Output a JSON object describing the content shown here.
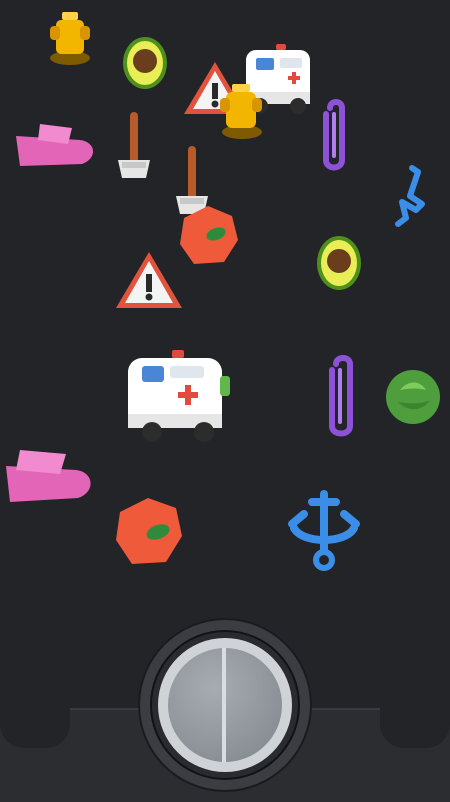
{
  "game": {
    "scene": "3d-object-matching-board",
    "background_color": "#232428",
    "collect_button": {
      "icon": "collect-button",
      "color": "#9ea4ab"
    }
  },
  "objects": [
    {
      "id": "trophy-1",
      "type": "trophy",
      "color": "#f4b400"
    },
    {
      "id": "avocado-1",
      "type": "avocado",
      "color": "#88c33a"
    },
    {
      "id": "warning-sign-1",
      "type": "warning-sign",
      "color": "#e2533d"
    },
    {
      "id": "ambulance-1",
      "type": "ambulance",
      "color": "#ffffff"
    },
    {
      "id": "trophy-2",
      "type": "trophy",
      "color": "#f4b400"
    },
    {
      "id": "paperclip-1",
      "type": "paperclip",
      "color": "#8e52d8"
    },
    {
      "id": "axe-1",
      "type": "axe",
      "color": "#c7642f"
    },
    {
      "id": "slipper-1",
      "type": "slipper",
      "color": "#e365b8"
    },
    {
      "id": "axe-2",
      "type": "axe",
      "color": "#c7642f"
    },
    {
      "id": "peach-1",
      "type": "peach",
      "color": "#ee5a3a"
    },
    {
      "id": "hook-1",
      "type": "hook",
      "color": "#3b8ee8"
    },
    {
      "id": "avocado-2",
      "type": "avocado",
      "color": "#88c33a"
    },
    {
      "id": "warning-sign-2",
      "type": "warning-sign",
      "color": "#e2533d"
    },
    {
      "id": "ambulance-2",
      "type": "ambulance",
      "color": "#ffffff"
    },
    {
      "id": "paperclip-2",
      "type": "paperclip",
      "color": "#8e52d8"
    },
    {
      "id": "cabbage-1",
      "type": "cabbage",
      "color": "#61b64c"
    },
    {
      "id": "slipper-2",
      "type": "slipper",
      "color": "#e365b8"
    },
    {
      "id": "peach-2",
      "type": "peach",
      "color": "#ee5a3a"
    },
    {
      "id": "anchor-1",
      "type": "anchor",
      "color": "#3b8ee8"
    }
  ]
}
